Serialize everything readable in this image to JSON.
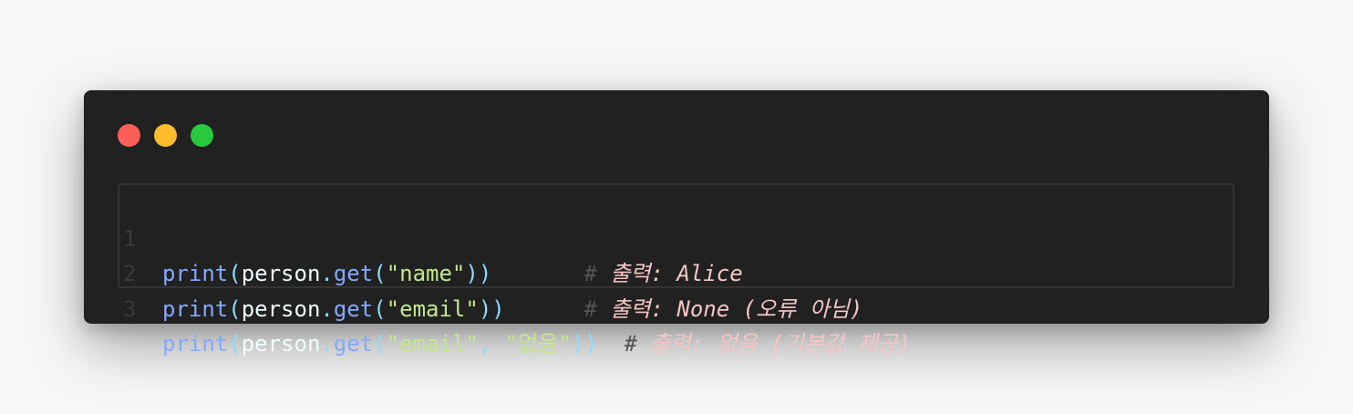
{
  "window": {
    "colors": {
      "background": "#212121",
      "close": "#ff5f56",
      "minimize": "#ffbd2e",
      "maximize": "#27c93f"
    }
  },
  "code": {
    "lines": [
      {
        "number": "1",
        "fn": "print",
        "var": "person",
        "method": "get",
        "arg1": "name",
        "arg2": null,
        "pad": "       ",
        "hash": "#",
        "comment": "출력: Alice"
      },
      {
        "number": "2",
        "fn": "print",
        "var": "person",
        "method": "get",
        "arg1": "email",
        "arg2": null,
        "pad": "      ",
        "hash": "#",
        "comment": "출력: None (오류 아님)"
      },
      {
        "number": "3",
        "fn": "print",
        "var": "person",
        "method": "get",
        "arg1": "email",
        "arg2": "없음",
        "pad": "  ",
        "hash": "#",
        "comment": "출력: 없음 (기본값 제공)"
      }
    ],
    "colors": {
      "function": "#82aaff",
      "punctuation": "#89ddff",
      "variable": "#eeffff",
      "string": "#c3e88d",
      "comment": "#f7c5c5",
      "line_number": "#3a3a3a"
    }
  }
}
